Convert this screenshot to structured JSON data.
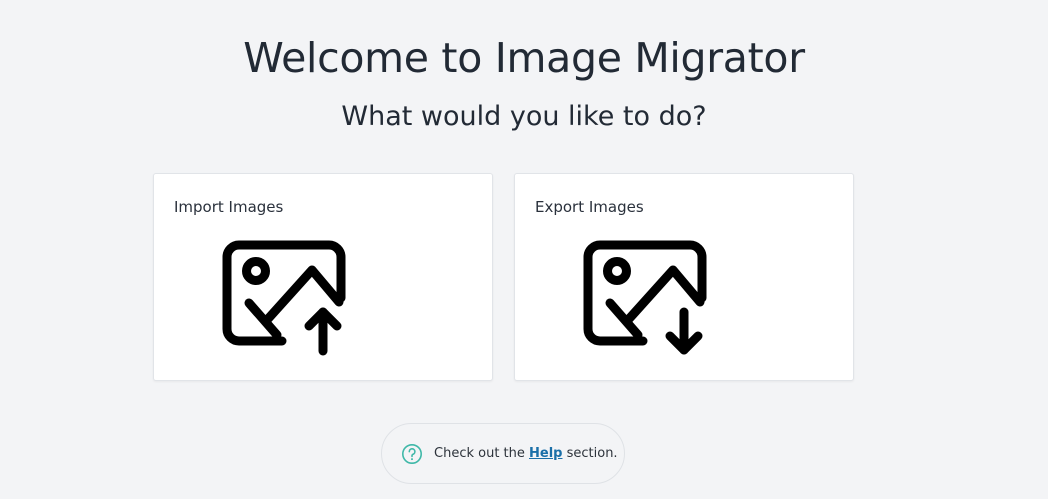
{
  "header": {
    "title": "Welcome to Image Migrator",
    "subtitle": "What would you like to do?"
  },
  "cards": {
    "import": {
      "label": "Import Images",
      "icon": "image-upload-icon"
    },
    "export": {
      "label": "Export Images",
      "icon": "image-download-icon"
    }
  },
  "help": {
    "icon": "help-circle-icon",
    "prefix": "Check out the ",
    "link_text": "Help",
    "suffix": " section.",
    "accent_color": "#3fb8a8",
    "link_color": "#1a6fa8"
  }
}
